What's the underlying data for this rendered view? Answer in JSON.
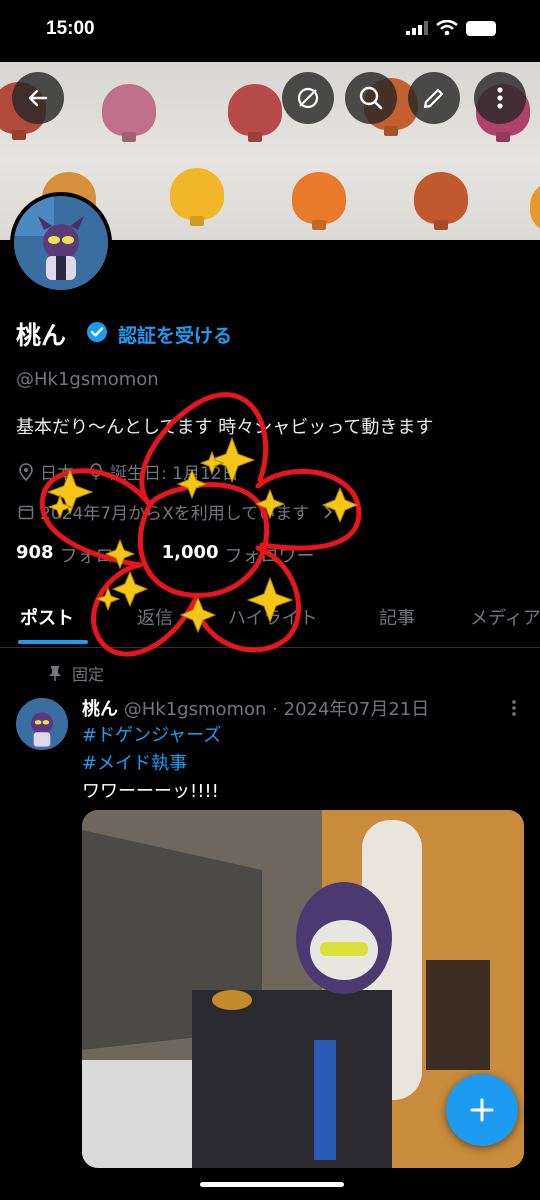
{
  "status_bar": {
    "time": "15:00"
  },
  "banner": {
    "back_icon": "arrow-left-icon",
    "action_icons": [
      "no-translate-icon",
      "search-icon",
      "edit-icon",
      "more-vertical-icon"
    ]
  },
  "profile": {
    "name": "桃ん",
    "verify_link": "認証を受ける",
    "handle": "@Hk1gsmomon",
    "bio": "基本だり〜んとしてます 時々シャビッって動きます",
    "location": "日本",
    "birthday": "誕生日: 1月12日",
    "joined": "2024年7月からXを利用しています",
    "following_count": "908",
    "following_label": "フォロー",
    "followers_count": "1,000",
    "followers_label": "フォロワー"
  },
  "tabs": [
    {
      "label": "ポスト",
      "active": true
    },
    {
      "label": "返信",
      "active": false
    },
    {
      "label": "ハイライト",
      "active": false
    },
    {
      "label": "記事",
      "active": false
    },
    {
      "label": "メディア",
      "active": false
    }
  ],
  "post": {
    "pinned_label": "固定",
    "author": "桃ん",
    "meta": "@Hk1gsmomon · 2024年07月21日",
    "hashtags": [
      "#ドゲンジャーズ",
      "#メイド執事"
    ],
    "text": "ワワーーーッ!!!!"
  },
  "colors": {
    "accent": "#1d9bf0",
    "background": "#000000",
    "muted": "#71767b",
    "doodle": "#e8161c"
  }
}
